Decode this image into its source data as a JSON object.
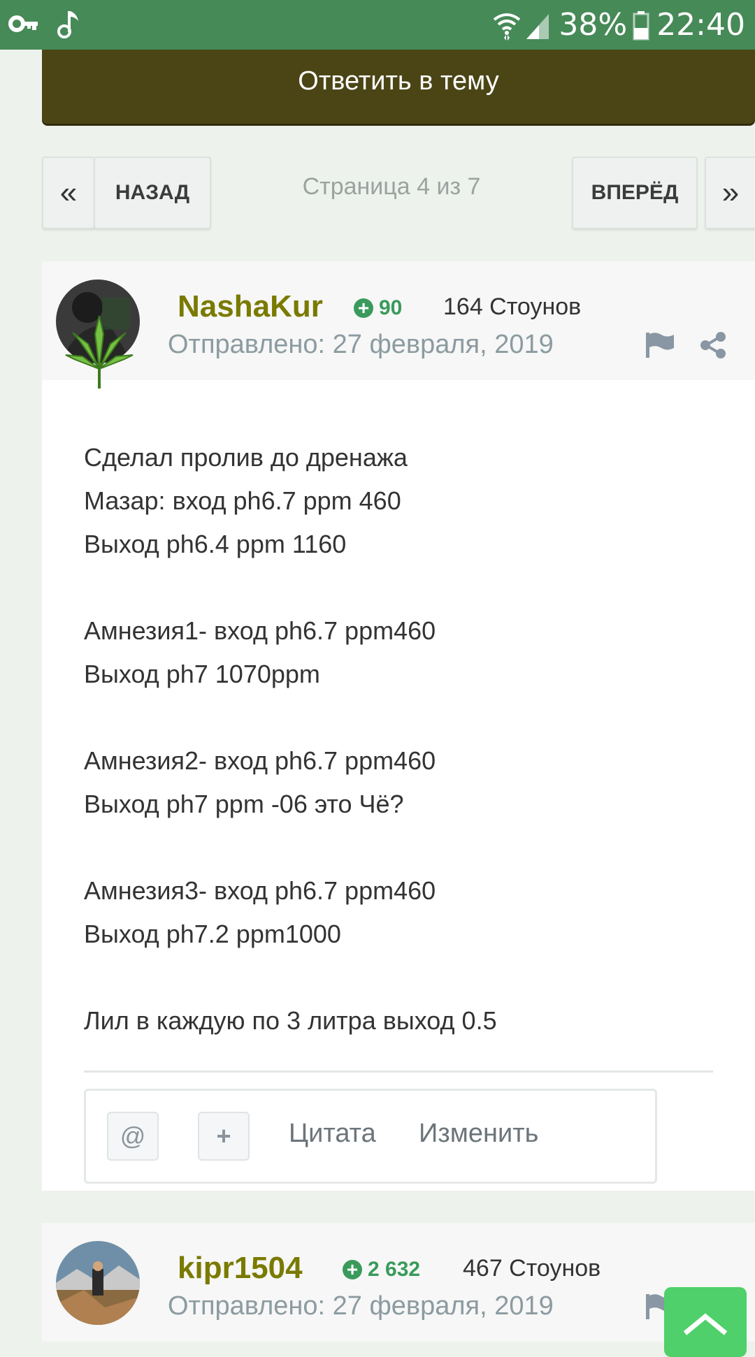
{
  "status_bar": {
    "battery_percent": "38%",
    "time": "22:40",
    "icons": [
      "key-icon",
      "music-note-icon",
      "wifi-icon",
      "signal-icon",
      "battery-icon"
    ]
  },
  "topic": {
    "reply_label": "Ответить в тему"
  },
  "pagination": {
    "prev_label": "НАЗАД",
    "next_label": "ВПЕРЁД",
    "page_info": "Страница 4 из 7",
    "first_glyph": "«",
    "last_glyph": "»"
  },
  "posts": [
    {
      "username": "NashaKur",
      "reputation": "90",
      "stones": "164 Стоунов",
      "date": "Отправлено: 27 февраля, 2019",
      "body_lines": [
        "Сделал пролив до дренажа",
        "Мазар: вход ph6.7 ppm 460",
        "Выход ph6.4 ppm 1160",
        "",
        "Амнезия1- вход ph6.7 ppm460",
        "Выход ph7 1070ppm",
        "",
        "Амнезия2- вход ph6.7 ppm460",
        "Выход ph7 ppm -06 это Чё?",
        "",
        "Амнезия3- вход ph6.7 ppm460",
        "Выход ph7.2 ppm1000",
        "",
        "Лил в каждую по 3 литра выход 0.5"
      ],
      "actions": {
        "mention": "@",
        "multiquote": "+",
        "quote": "Цитата",
        "edit": "Изменить"
      }
    },
    {
      "username": "kipr1504",
      "reputation": "2 632",
      "stones": "467 Стоунов",
      "date": "Отправлено: 27 февраля, 2019"
    }
  ],
  "colors": {
    "status_bar": "#468a57",
    "reply_button": "#4b4516",
    "username": "#7a7a00",
    "reputation": "#3a9a5c",
    "scroll_top": "#4fd06a"
  }
}
